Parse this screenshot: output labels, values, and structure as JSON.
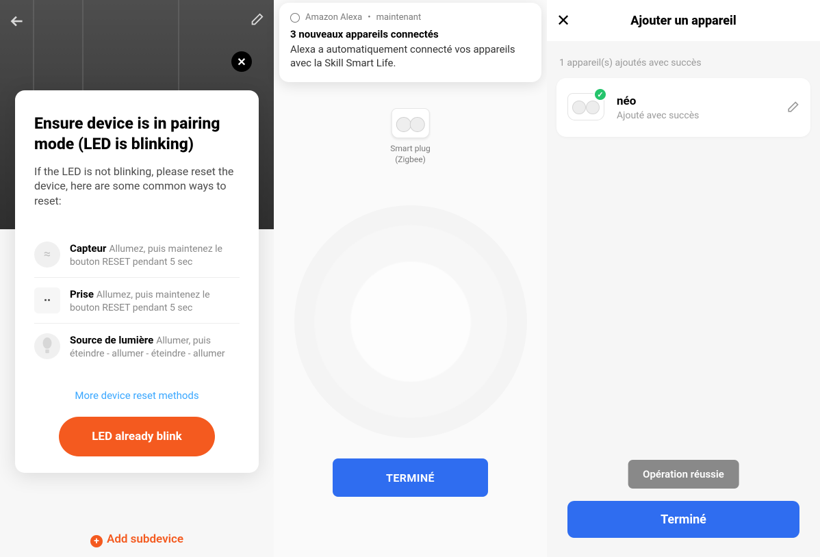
{
  "s1": {
    "title": "Ensure device is in pairing mode (LED is blinking)",
    "subtitle": "If the LED is not blinking, please reset the device, here are some common ways to reset:",
    "resets": [
      {
        "name": "Capteur",
        "desc": "Allumez, puis maintenez le bouton RESET pendant 5 sec"
      },
      {
        "name": "Prise",
        "desc": "Allumez, puis maintenez le bouton RESET pendant 5 sec"
      },
      {
        "name": "Source de lumière",
        "desc": "Allumer, puis éteindre - allumer - éteindre - allumer"
      }
    ],
    "more": "More device reset methods",
    "cta": "LED already blink",
    "add_sub": "Add subdevice"
  },
  "s2": {
    "notif_source": "Amazon Alexa",
    "notif_time": "maintenant",
    "notif_title": "3 nouveaux appareils connectés",
    "notif_body": "Alexa a automatiquement connecté vos appareils avec la Skill Smart Life.",
    "device_label_1": "Smart plug",
    "device_label_2": "(Zigbee)",
    "termine": "TERMINÉ"
  },
  "s3": {
    "title": "Ajouter un appareil",
    "status": "1 appareil(s) ajoutés avec succès",
    "device_name": "néo",
    "device_status": "Ajouté avec succès",
    "toast": "Opération réussie",
    "termine": "Terminé"
  }
}
